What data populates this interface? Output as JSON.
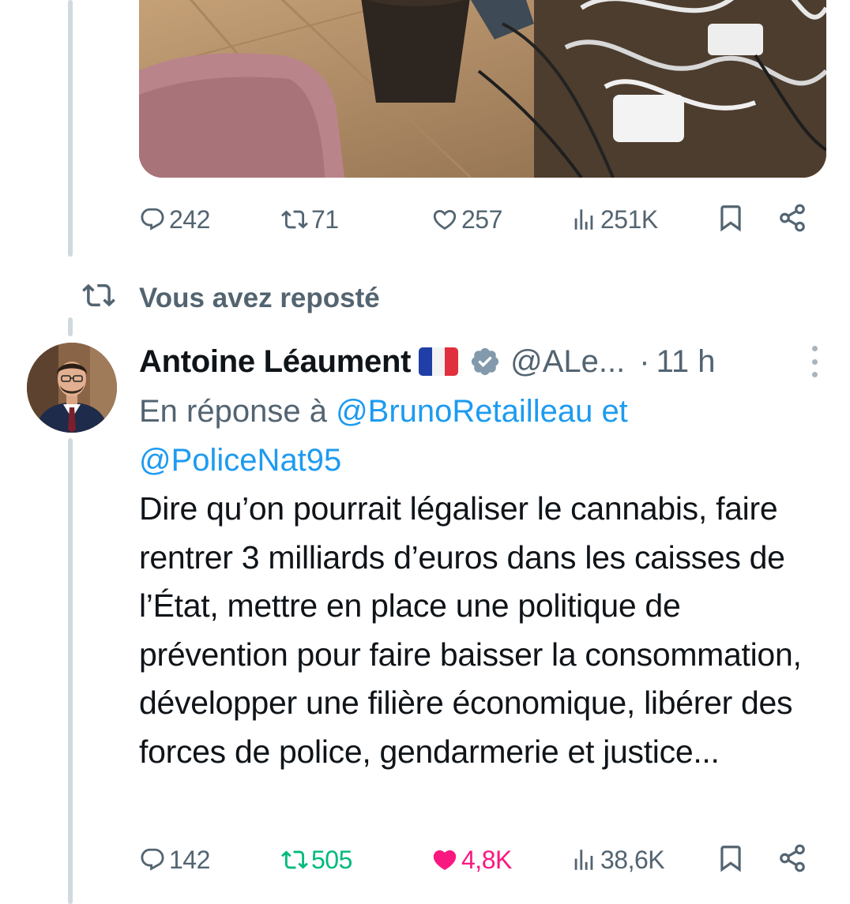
{
  "top_tweet": {
    "stats": {
      "replies": "242",
      "reposts": "71",
      "likes": "257",
      "views": "251K"
    }
  },
  "repost_banner": {
    "label": "Vous avez reposté"
  },
  "tweet": {
    "author_name": "Antoine Léaument",
    "handle": "@ALe...",
    "dot": "·",
    "time": "11 h",
    "reply_prefix": "En réponse à",
    "reply_mention_1": "@BrunoRetailleau",
    "reply_conjunction": "et",
    "reply_mention_2": "@PoliceNat95",
    "text": "Dire qu’on pourrait légaliser le cannabis, faire rentrer 3 milliards d’euros dans les caisses de l’État, mettre en place une politique de prévention pour faire baisser la consommation, développer une filière économique, libérer des forces de police, gendarmerie et justice...",
    "stats": {
      "replies": "142",
      "reposts": "505",
      "likes": "4,8K",
      "views": "38,6K"
    }
  },
  "colors": {
    "secondary_text": "#536471",
    "link": "#1d9bf0",
    "repost_active": "#00ba7c",
    "like_active": "#f91880",
    "verified_badge": "#829aab",
    "thread_line": "#cfd9de"
  },
  "icons": {
    "reply": "speech-bubble-icon",
    "repost": "repost-arrows-icon",
    "like": "heart-icon",
    "views": "bar-chart-icon",
    "bookmark": "bookmark-icon",
    "share": "share-icon",
    "verified": "verified-badge-icon",
    "more": "more-vertical-icon"
  }
}
